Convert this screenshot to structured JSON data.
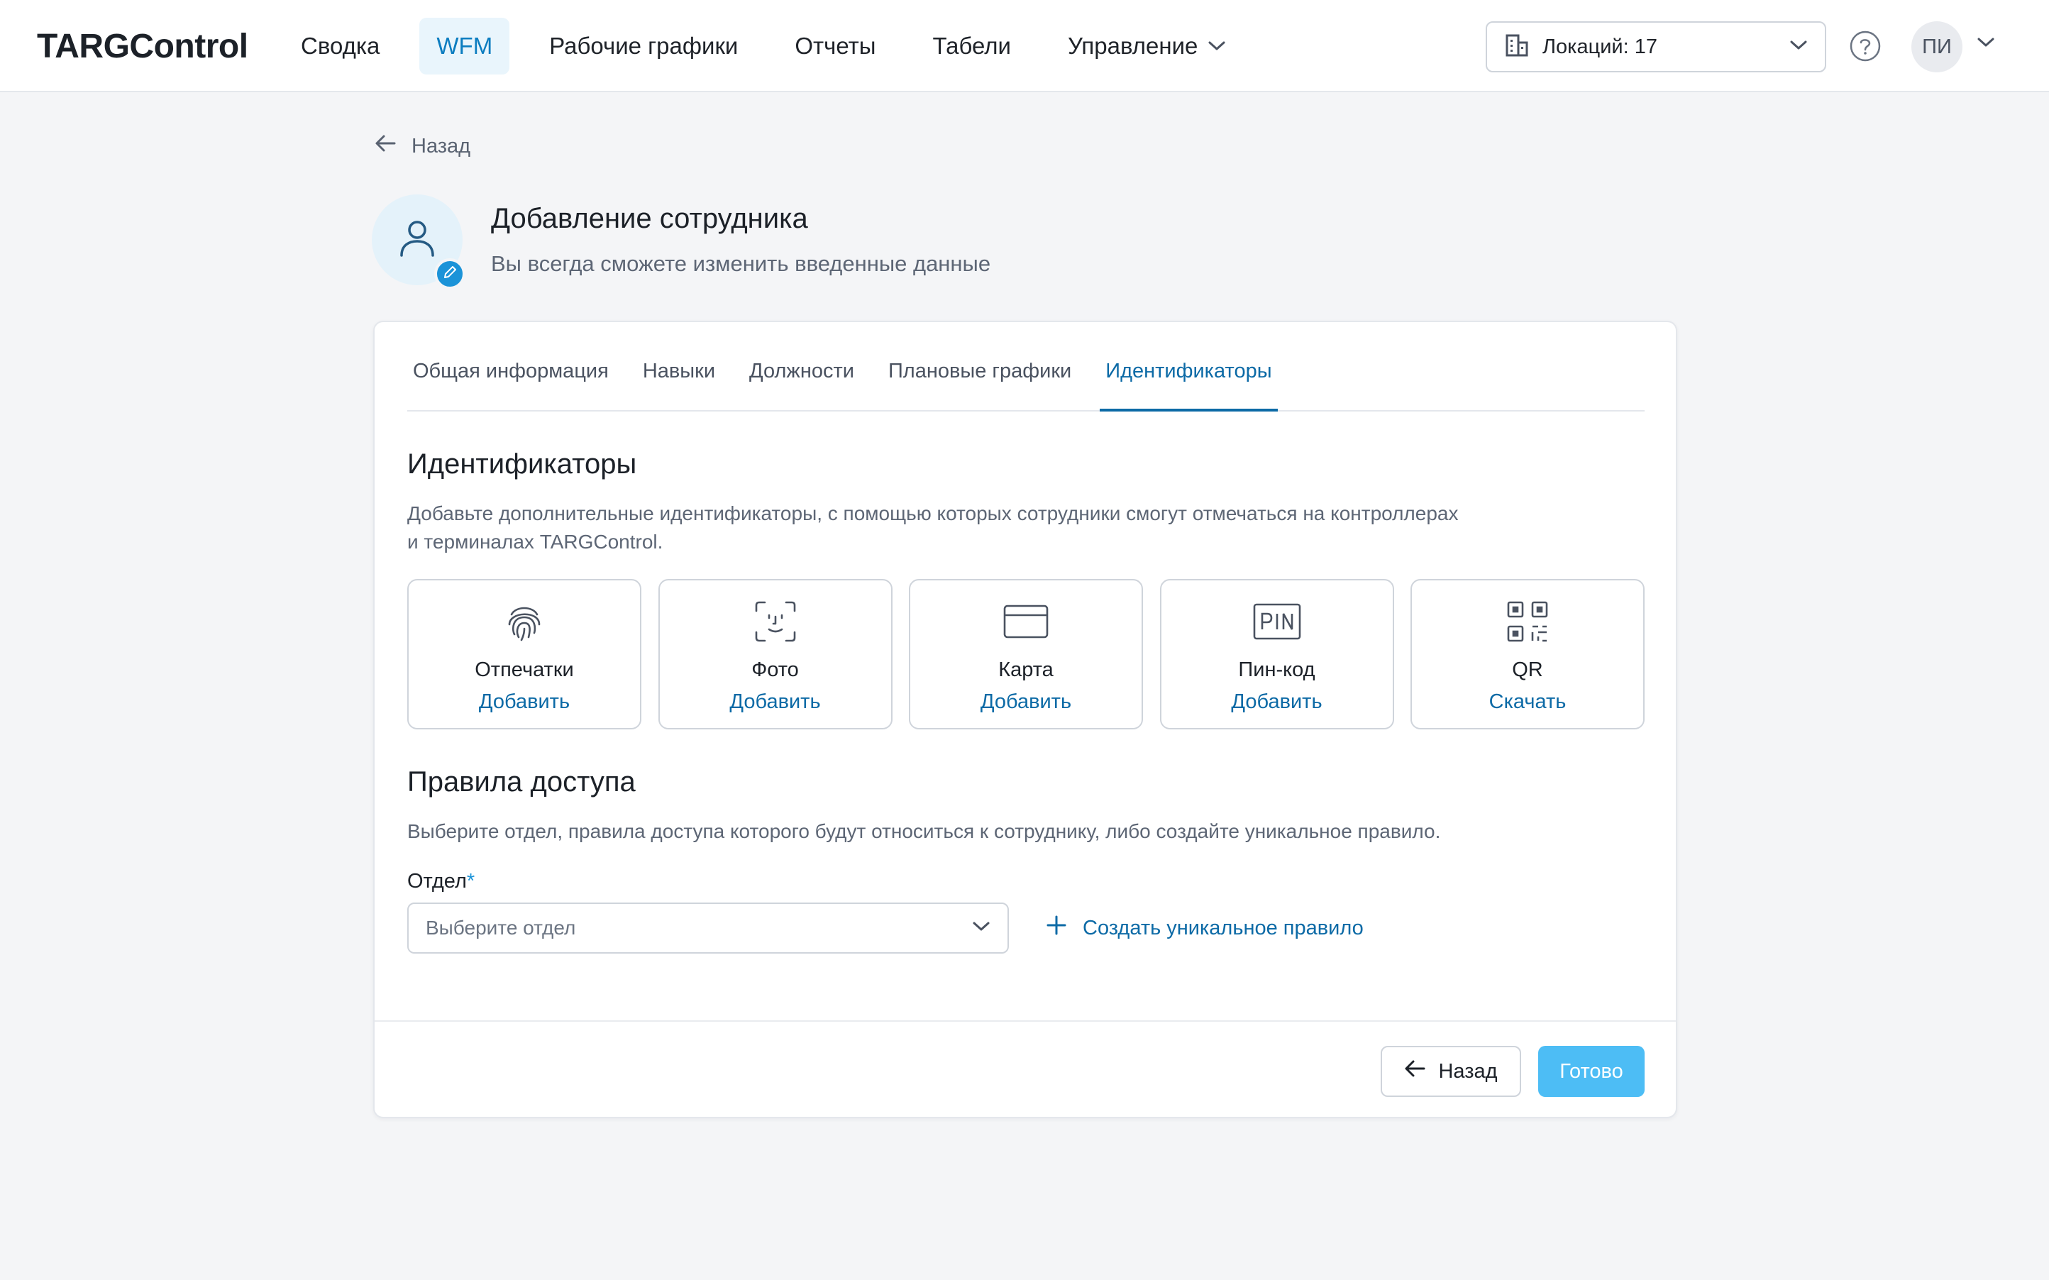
{
  "app": {
    "logo": "TARGControl"
  },
  "nav": {
    "items": [
      {
        "label": "Сводка"
      },
      {
        "label": "WFM",
        "active": true
      },
      {
        "label": "Рабочие графики"
      },
      {
        "label": "Отчеты"
      },
      {
        "label": "Табели"
      },
      {
        "label": "Управление",
        "has_dropdown": true
      }
    ],
    "locations_label": "Локаций: 17",
    "user_initials": "ПИ"
  },
  "header": {
    "back_label": "Назад",
    "title": "Добавление сотрудника",
    "subtitle": "Вы всегда сможете изменить введенные данные"
  },
  "tabs": [
    {
      "label": "Общая информация"
    },
    {
      "label": "Навыки"
    },
    {
      "label": "Должности"
    },
    {
      "label": "Плановые графики"
    },
    {
      "label": "Идентификаторы",
      "active": true
    }
  ],
  "identifiers": {
    "title": "Идентификаторы",
    "description_line1": "Добавьте дополнительные идентификаторы, с помощью которых сотрудники смогут отмечаться на контроллерах",
    "description_line2": "и терминалах TARGControl.",
    "items": [
      {
        "name": "Отпечатки",
        "action": "Добавить",
        "icon": "fingerprint-icon"
      },
      {
        "name": "Фото",
        "action": "Добавить",
        "icon": "face-scan-icon"
      },
      {
        "name": "Карта",
        "action": "Добавить",
        "icon": "card-icon"
      },
      {
        "name": "Пин-код",
        "action": "Добавить",
        "icon": "pin-icon"
      },
      {
        "name": "QR",
        "action": "Скачать",
        "icon": "qr-code-icon"
      }
    ]
  },
  "access": {
    "title": "Правила доступа",
    "description": "Выберите отдел, правила доступа которого будут относиться к сотруднику, либо создайте уникальное правило.",
    "department_label": "Отдел",
    "required_mark": "*",
    "department_placeholder": "Выберите отдел",
    "create_rule_label": "Создать уникальное правило"
  },
  "footer": {
    "back_label": "Назад",
    "done_label": "Готово"
  },
  "colors": {
    "accent": "#0c6aa6",
    "primary_button": "#4dbdf5",
    "active_nav_bg": "#e9f5fc",
    "page_bg": "#f4f5f7"
  }
}
